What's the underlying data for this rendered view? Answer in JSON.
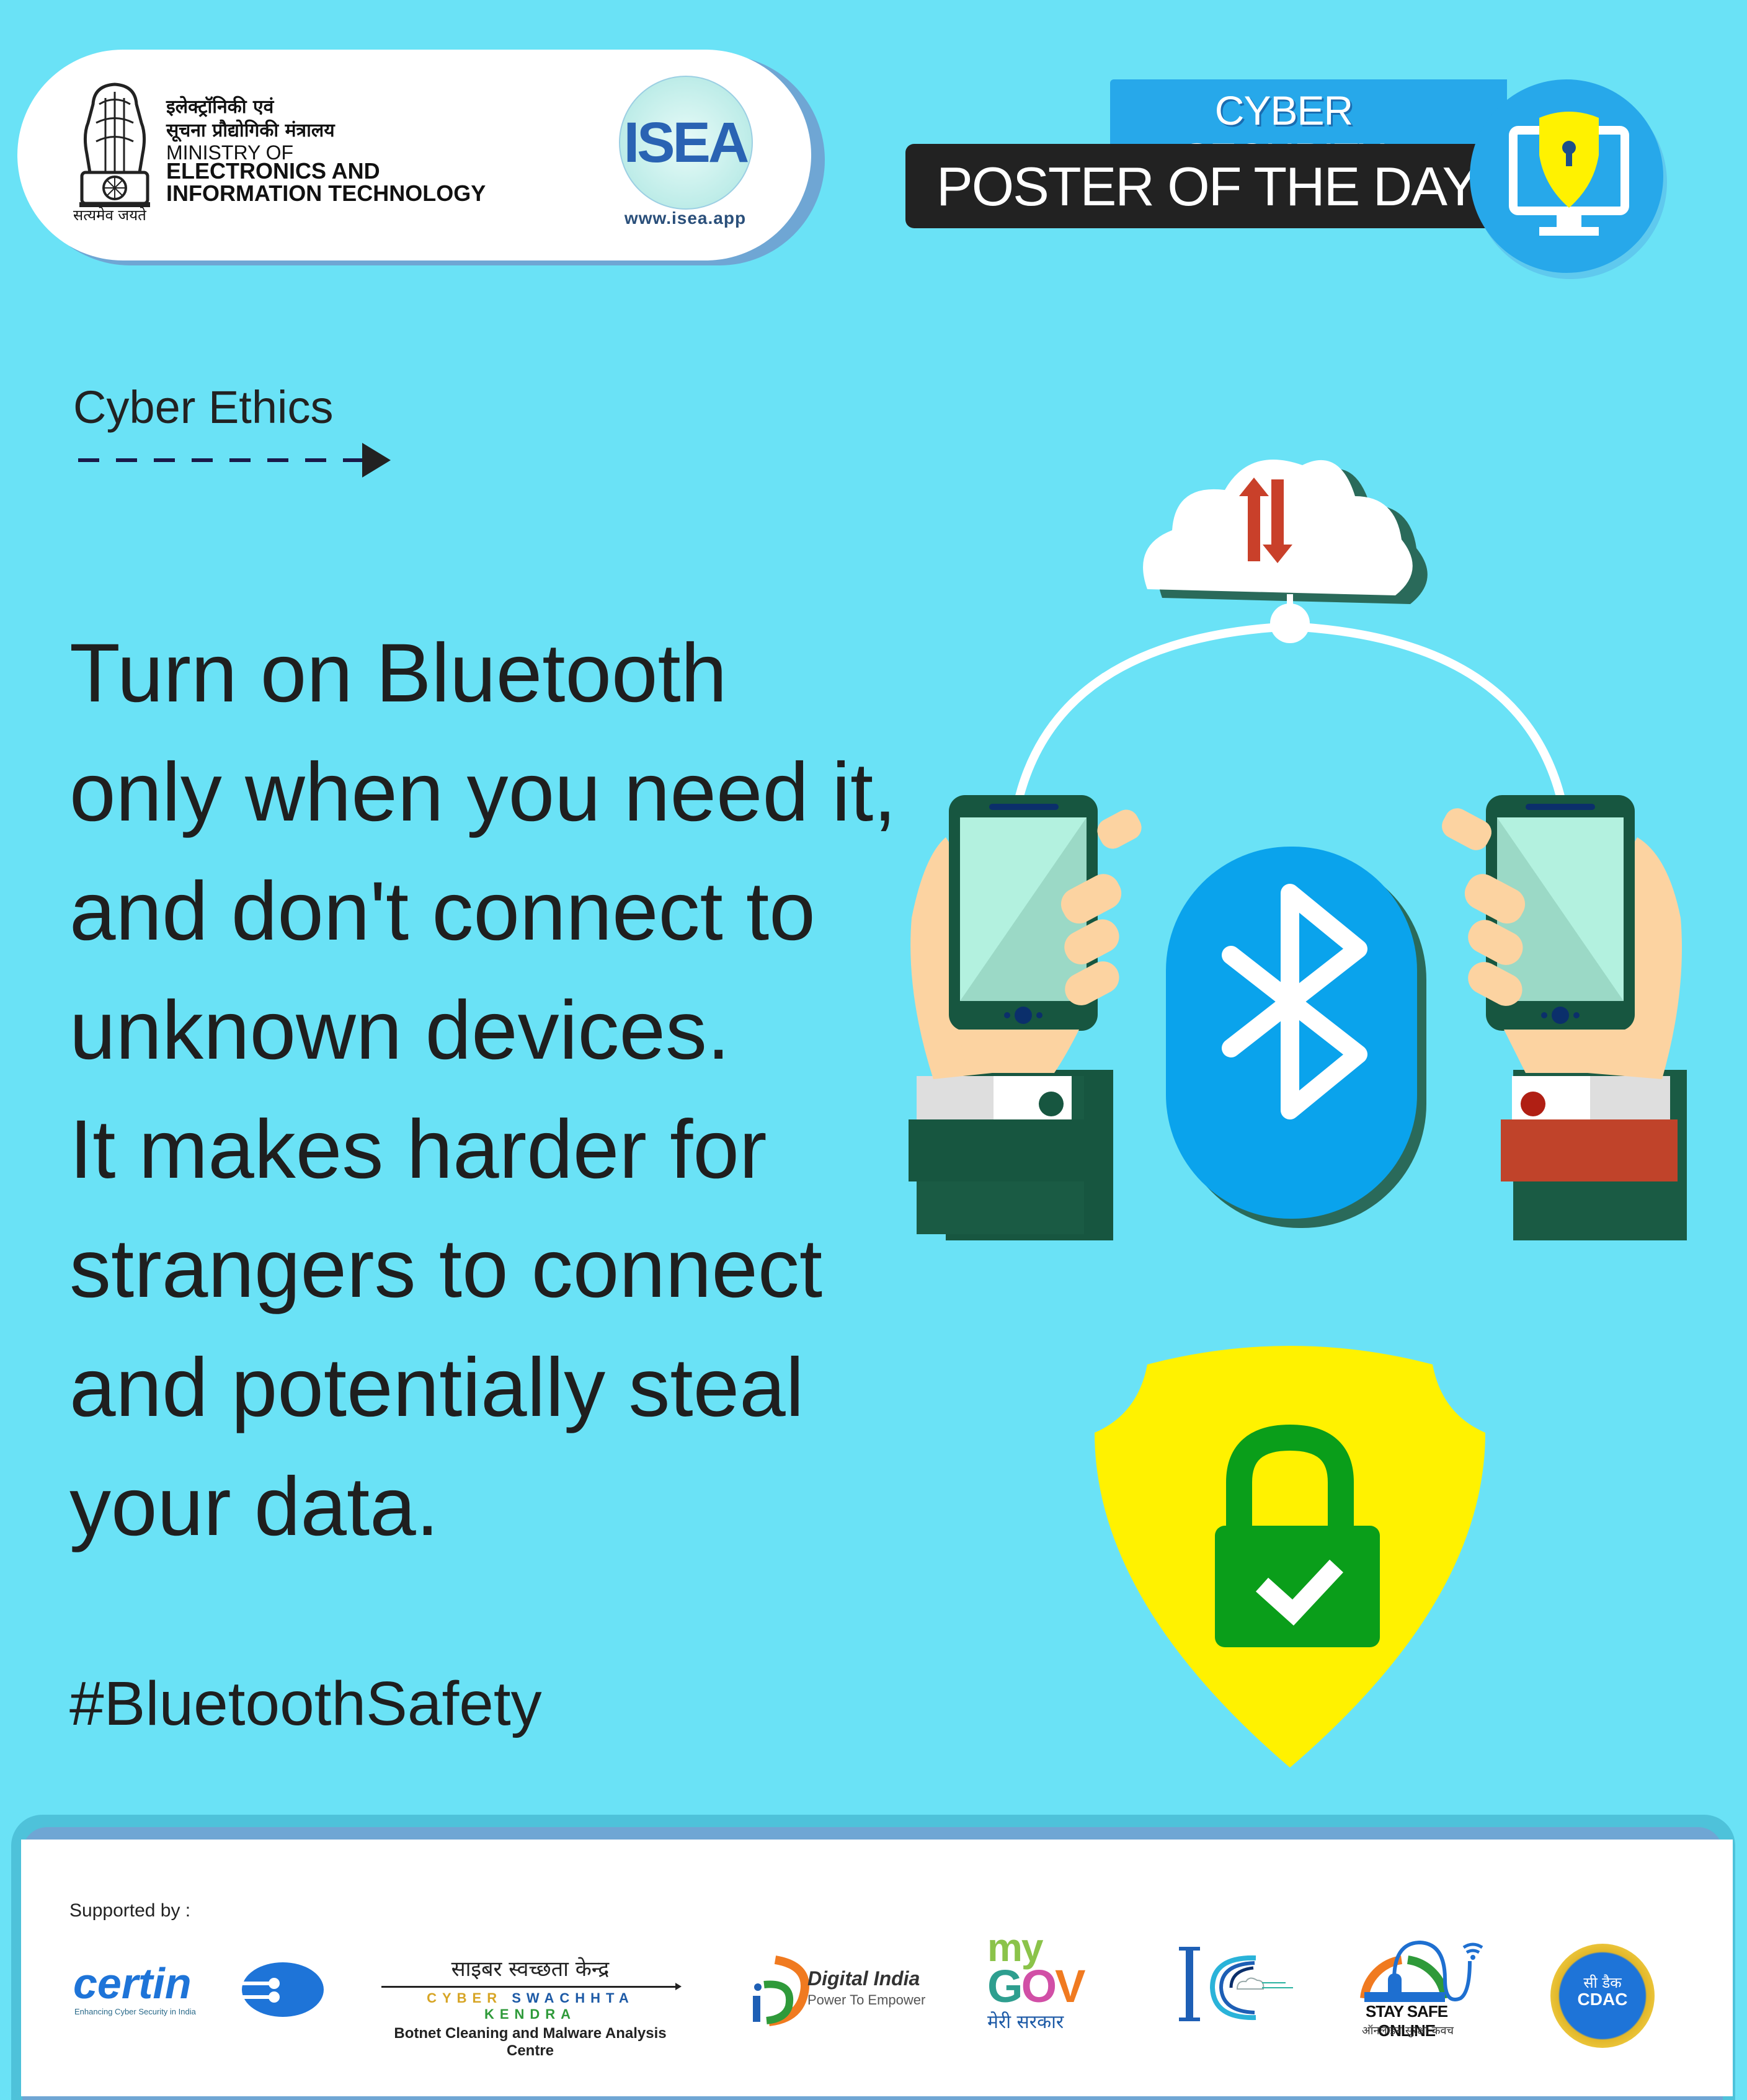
{
  "header": {
    "ministry": {
      "hindi_line1": "इलेक्ट्रॉनिकी एवं",
      "hindi_line2": "सूचना प्रौद्योगिकी मंत्रालय",
      "english_line1": "MINISTRY OF",
      "english_line2": "ELECTRONICS AND",
      "english_line3": "INFORMATION TECHNOLOGY",
      "motto": "सत्यमेव जयते",
      "emblem_icon": "national-emblem"
    },
    "isea": {
      "logo_text": "ISEA",
      "url": "www.isea.app"
    },
    "badge": {
      "top_label": "CYBER SECURITY",
      "main_label": "POSTER OF THE DAY",
      "icon": "monitor-shield-keyhole"
    }
  },
  "content": {
    "category": "Cyber Ethics",
    "message_lines": [
      "Turn on Bluetooth",
      "only when you need it,",
      "and don't connect to",
      "unknown devices.",
      "It makes harder for",
      "strangers to connect",
      "and potentially steal",
      "your data."
    ],
    "hashtag": "#BluetoothSafety"
  },
  "illustration": {
    "icons": [
      "cloud-sync-icon",
      "bluetooth-icon",
      "phone-in-hand-left",
      "phone-in-hand-right",
      "shield-lock-check-icon"
    ]
  },
  "footer": {
    "supported_by": "Supported by :",
    "certin": {
      "name": "certin",
      "tagline": "Enhancing Cyber Security in India"
    },
    "csk": {
      "hindi": "साइबर स्वच्छता केन्द्र",
      "english_words": [
        "CYBER",
        "SWACHHTA",
        "KENDRA"
      ],
      "subtitle": "Botnet Cleaning and Malware Analysis Centre"
    },
    "digital_india": {
      "title": "Digital India",
      "tagline": "Power To Empower"
    },
    "mygov": {
      "my": "my",
      "g": "G",
      "o": "O",
      "v": "V",
      "hindi": "मेरी सरकार"
    },
    "ic": {
      "letter": "I"
    },
    "stay_safe": {
      "title": "STAY SAFE ONLINE",
      "hindi": "ऑनलाइन सुरक्षा कवच"
    },
    "cdac": {
      "hindi": "सी डैक",
      "english": "CDAC"
    }
  },
  "colors": {
    "background": "#6ae2f6",
    "text": "#1f1f1f",
    "badge_blue": "#27a8ea",
    "badge_dark": "#222222",
    "bluetooth_blue": "#0aa3ec",
    "cloud_arrow_red": "#c9402a",
    "shield_yellow": "#fff200",
    "lock_green": "#0a9e1a",
    "phone_green": "#175640",
    "skin": "#fcd3a1",
    "sleeve_red": "#c0432a"
  }
}
